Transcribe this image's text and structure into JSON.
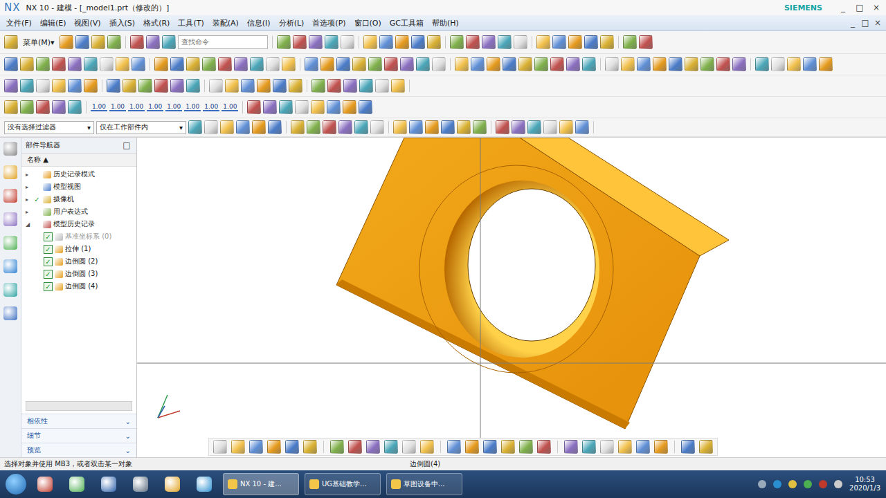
{
  "window": {
    "title": "NX 10 - 建模 - [_model1.prt（修改的）]",
    "brand": "SIEMENS",
    "controls": [
      "_",
      "□",
      "×"
    ],
    "sub_controls": [
      "_",
      "□",
      "×"
    ]
  },
  "menu": [
    "文件(F)",
    "编辑(E)",
    "视图(V)",
    "插入(S)",
    "格式(R)",
    "工具(T)",
    "装配(A)",
    "信息(I)",
    "分析(L)",
    "首选项(P)",
    "窗口(O)",
    "GC工具箱",
    "帮助(H)"
  ],
  "toolbar": {
    "menu_button": "菜单(M)▾",
    "search_placeholder": "查找命令",
    "dimension_buttons": [
      "1.00",
      "1.00",
      "1.00",
      "1.00",
      "1.00",
      "1.00",
      "1.00",
      "1.00"
    ]
  },
  "filters": [
    "没有选择过滤器",
    "仅在工作部件内"
  ],
  "navigator": {
    "title": "部件导航器",
    "column": "名称 ▲",
    "items": [
      {
        "label": "历史记录模式",
        "kind": "node",
        "depth": 0,
        "expanded": false,
        "checked": false,
        "disabled": false
      },
      {
        "label": "模型视图",
        "kind": "node",
        "depth": 0,
        "expanded": false,
        "checked": false,
        "disabled": false
      },
      {
        "label": "摄像机",
        "kind": "node",
        "depth": 0,
        "expanded": false,
        "checked": true,
        "disabled": false
      },
      {
        "label": "用户表达式",
        "kind": "node",
        "depth": 0,
        "expanded": false,
        "checked": false,
        "disabled": false
      },
      {
        "label": "模型历史记录",
        "kind": "node",
        "depth": 0,
        "expanded": true,
        "checked": false,
        "disabled": false
      },
      {
        "label": "基准坐标系 (0)",
        "kind": "feature",
        "depth": 1,
        "expanded": false,
        "checked": true,
        "disabled": true
      },
      {
        "label": "拉伸 (1)",
        "kind": "feature",
        "depth": 1,
        "expanded": false,
        "checked": true,
        "disabled": false
      },
      {
        "label": "边倒圆 (2)",
        "kind": "feature",
        "depth": 1,
        "expanded": false,
        "checked": true,
        "disabled": false
      },
      {
        "label": "边倒圆 (3)",
        "kind": "feature",
        "depth": 1,
        "expanded": false,
        "checked": true,
        "disabled": false
      },
      {
        "label": "边倒圆 (4)",
        "kind": "feature",
        "depth": 1,
        "expanded": false,
        "checked": true,
        "disabled": false
      }
    ]
  },
  "panels": [
    "相依性",
    "细节",
    "预览"
  ],
  "status_bar": {
    "prompt": "选择对象并使用 MB3，或者双击某一对象",
    "selection": "边倒圆(4)"
  },
  "taskbar": {
    "items": [
      {
        "label": "NX 10 - 建...",
        "selected": true
      },
      {
        "label": "UG基础教学...",
        "selected": false
      },
      {
        "label": "草图设备中...",
        "selected": false
      }
    ],
    "time": "10:53",
    "date": "2020/1/3"
  }
}
